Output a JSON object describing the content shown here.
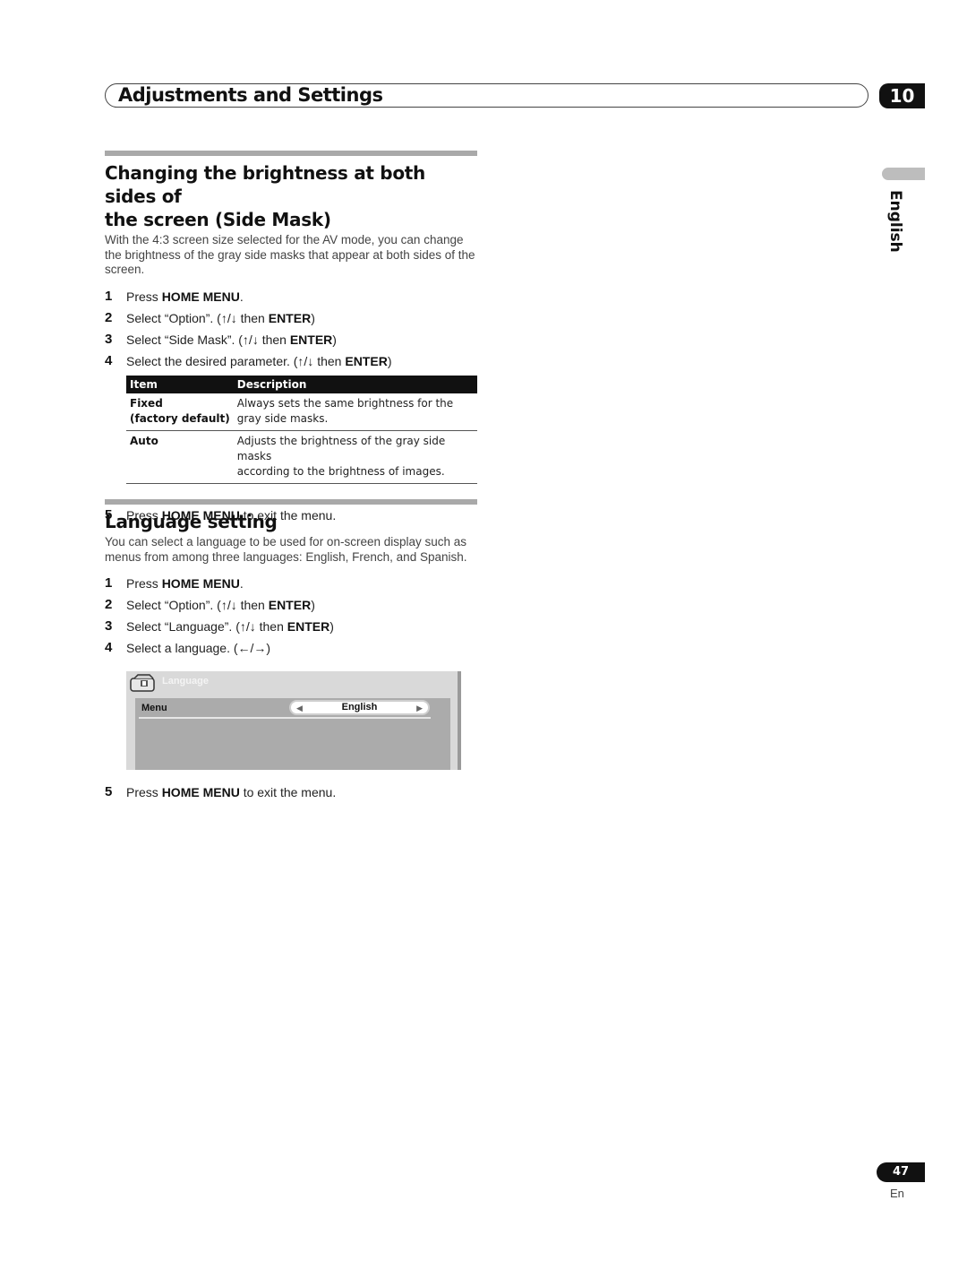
{
  "header": {
    "chapter_title": "Adjustments and Settings",
    "chapter_number": "10"
  },
  "side_tab": {
    "language": "English"
  },
  "section1": {
    "title_line1": "Changing the brightness at both sides of",
    "title_line2": "the screen (Side Mask)",
    "intro": "With the 4:3 screen size selected for the AV mode, you can change the brightness of the gray side masks that appear at both sides of the screen.",
    "steps": [
      {
        "num": "1",
        "pre": "Press ",
        "bold": "HOME MENU",
        "post": "."
      },
      {
        "num": "2",
        "pre": "Select “Option”. (↑/↓ then ",
        "bold": "ENTER",
        "post": ")"
      },
      {
        "num": "3",
        "pre": "Select “Side Mask”. (↑/↓ then ",
        "bold": "ENTER",
        "post": ")"
      },
      {
        "num": "4",
        "pre": "Select the desired parameter. (↑/↓ then ",
        "bold": "ENTER",
        "post": ")"
      }
    ],
    "table": {
      "headers": [
        "Item",
        "Description"
      ],
      "rows": [
        {
          "item_line1": "Fixed",
          "item_line2": "(factory default)",
          "desc_line1": "Always sets the same brightness for the",
          "desc_line2": "gray side masks."
        },
        {
          "item_line1": "Auto",
          "item_line2": "",
          "desc_line1": "Adjusts the brightness of the gray side masks",
          "desc_line2": "according to the brightness of images."
        }
      ]
    },
    "step5": {
      "num": "5",
      "pre": "Press ",
      "bold": "HOME MENU",
      "post": " to exit the menu."
    }
  },
  "section2": {
    "title": "Language setting",
    "intro": "You can select a language to be used for on-screen display such as menus from among three languages: English, French, and Spanish.",
    "steps": [
      {
        "num": "1",
        "pre": "Press ",
        "bold": "HOME MENU",
        "post": "."
      },
      {
        "num": "2",
        "pre": "Select “Option”. (↑/↓ then ",
        "bold": "ENTER",
        "post": ")"
      },
      {
        "num": "3",
        "pre": "Select “Language”. (↑/↓ then ",
        "bold": "ENTER",
        "post": ")"
      },
      {
        "num": "4",
        "pre": "Select a language. (←/→)",
        "bold": "",
        "post": ""
      }
    ],
    "osd": {
      "title": "Language",
      "row_label": "Menu",
      "value": "English",
      "left_arrow": "◀",
      "right_arrow": "▶"
    },
    "step5": {
      "num": "5",
      "pre": "Press ",
      "bold": "HOME MENU",
      "post": " to exit the menu."
    }
  },
  "footer": {
    "page_number": "47",
    "lang_code": "En"
  }
}
